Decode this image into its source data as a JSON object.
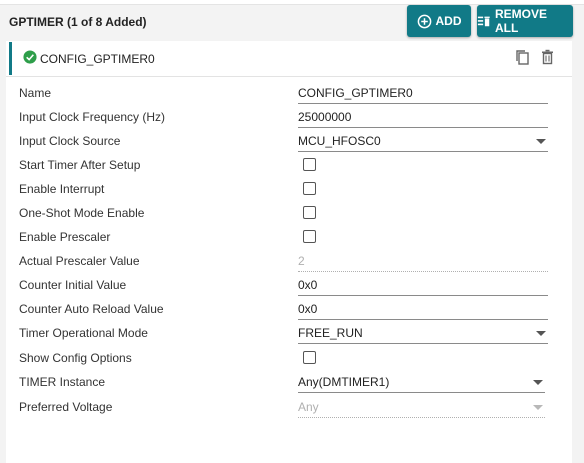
{
  "header": {
    "title": "GPTIMER (1 of 8 Added)",
    "add_label": "ADD",
    "remove_all_label": "REMOVE ALL"
  },
  "card": {
    "title": "CONFIG_GPTIMER0",
    "status_color": "#2e9e4a"
  },
  "fields": [
    {
      "label": "Name",
      "type": "text",
      "value": "CONFIG_GPTIMER0"
    },
    {
      "label": "Input Clock Frequency (Hz)",
      "type": "text",
      "value": "25000000"
    },
    {
      "label": "Input Clock Source",
      "type": "select",
      "value": "MCU_HFOSC0"
    },
    {
      "label": "Start Timer After Setup",
      "type": "checkbox",
      "checked": false
    },
    {
      "label": "Enable Interrupt",
      "type": "checkbox",
      "checked": false
    },
    {
      "label": "One-Shot Mode Enable",
      "type": "checkbox",
      "checked": false
    },
    {
      "label": "Enable Prescaler",
      "type": "checkbox",
      "checked": false
    },
    {
      "label": "Actual Prescaler Value",
      "type": "text",
      "value": "2",
      "disabled": true
    },
    {
      "label": "Counter Initial Value",
      "type": "text",
      "value": "0x0"
    },
    {
      "label": "Counter Auto Reload Value",
      "type": "text",
      "value": "0x0"
    },
    {
      "label": "Timer Operational Mode",
      "type": "select",
      "value": "FREE_RUN"
    },
    {
      "label": "Show Config Options",
      "type": "checkbox",
      "checked": false
    },
    {
      "label": "TIMER Instance",
      "type": "select",
      "value": "Any(DMTIMER1)"
    },
    {
      "label": "Preferred Voltage",
      "type": "select",
      "value": "Any",
      "disabled": true
    }
  ],
  "colors": {
    "accent": "#117a87",
    "background": "#f3f3f3"
  }
}
